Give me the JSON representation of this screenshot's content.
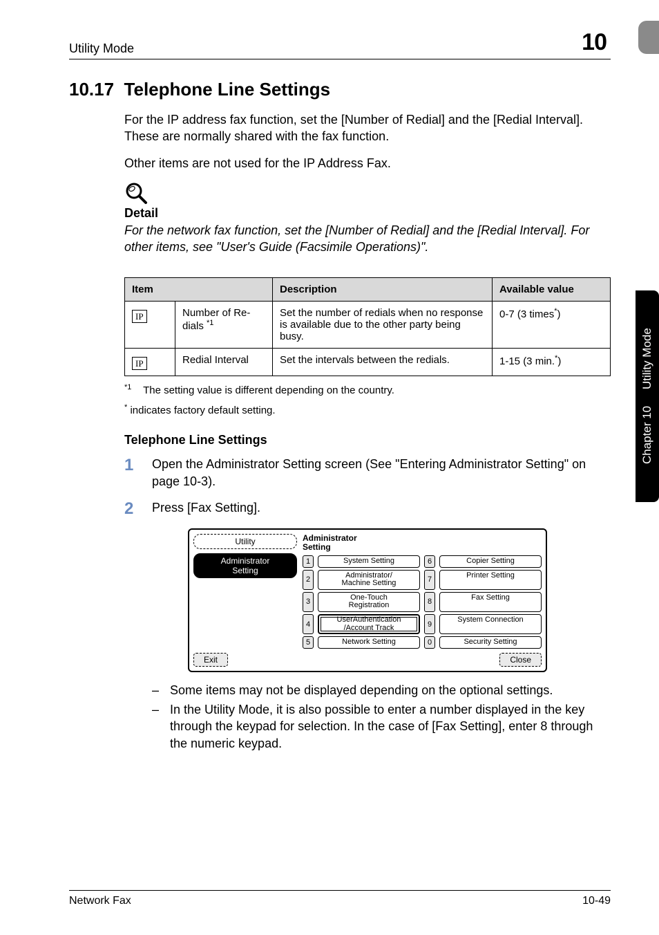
{
  "header": {
    "running_head": "Utility Mode",
    "chapter_number": "10"
  },
  "section": {
    "number": "10.17",
    "title": "Telephone Line Settings",
    "para1": "For the IP address fax function, set the [Number of Redial] and the [Redial Interval]. These are normally shared with the fax function.",
    "para2": "Other items are not used for the IP Address Fax."
  },
  "detail": {
    "label": "Detail",
    "text": "For the network fax function, set the [Number of Redial] and the [Redial Interval]. For other items, see \"User's Guide (Facsimile Operations)\"."
  },
  "table": {
    "headers": {
      "item": "Item",
      "desc": "Description",
      "avail": "Available value"
    },
    "rows": [
      {
        "badge": "IP",
        "name": "Number of Re-dials ",
        "name_sup": "*1",
        "desc": "Set the number of redials when no response is available due to the other party being busy.",
        "avail_pre": "0-7 (3 times",
        "avail_sup": "*",
        "avail_post": ")"
      },
      {
        "badge": "IP",
        "name": "Redial Interval",
        "name_sup": "",
        "desc": "Set the intervals between the redials.",
        "avail_pre": "1-15 (3 min.",
        "avail_sup": "*",
        "avail_post": ")"
      }
    ]
  },
  "footnotes": {
    "fn1_mark": "*1",
    "fn1_text": "The setting value is different depending on the country.",
    "fn2_mark": "*",
    "fn2_text": " indicates factory default setting."
  },
  "subheading": "Telephone Line Settings",
  "steps": [
    {
      "num": "1",
      "text": "Open the Administrator Setting screen (See \"Entering Administrator Setting\" on page 10-3)."
    },
    {
      "num": "2",
      "text": "Press [Fax Setting]."
    }
  ],
  "screenshot": {
    "left_title": "Utility",
    "left_active_line1": "Administrator",
    "left_active_line2": "Setting",
    "right_title_line1": "Administrator",
    "right_title_line2": "Setting",
    "menu": [
      {
        "n": "1",
        "label": "System Setting"
      },
      {
        "n": "6",
        "label": "Copier Setting"
      },
      {
        "n": "2",
        "label": "Administrator/\nMachine Setting"
      },
      {
        "n": "7",
        "label": "Printer Setting"
      },
      {
        "n": "3",
        "label": "One-Touch\nRegistration"
      },
      {
        "n": "8",
        "label": "Fax Setting"
      },
      {
        "n": "4",
        "label": "UserAuthentication\n/Account Track"
      },
      {
        "n": "9",
        "label": "System Connection"
      },
      {
        "n": "5",
        "label": "Network Setting"
      },
      {
        "n": "0",
        "label": "Security Setting"
      }
    ],
    "exit": "Exit",
    "close": "Close"
  },
  "dash_list": [
    "Some items may not be displayed depending on the optional settings.",
    "In the Utility Mode, it is also possible to enter a number displayed in the key through the keypad for selection. In the case of [Fax Setting], enter 8 through the numeric keypad."
  ],
  "side_tab": {
    "bottom": "Utility Mode",
    "top": "Chapter 10"
  },
  "footer": {
    "left": "Network Fax",
    "right": "10-49"
  },
  "chart_data": {
    "type": "table",
    "title": "Telephone Line Settings — items",
    "columns": [
      "Item",
      "Description",
      "Available value"
    ],
    "rows": [
      [
        "IP — Number of Re-dials *1",
        "Set the number of redials when no response is available due to the other party being busy.",
        "0-7 (3 times*)"
      ],
      [
        "IP — Redial Interval",
        "Set the intervals between the redials.",
        "1-15 (3 min.*)"
      ]
    ],
    "footnotes": [
      "*1 The setting value is different depending on the country.",
      "* indicates factory default setting."
    ]
  }
}
